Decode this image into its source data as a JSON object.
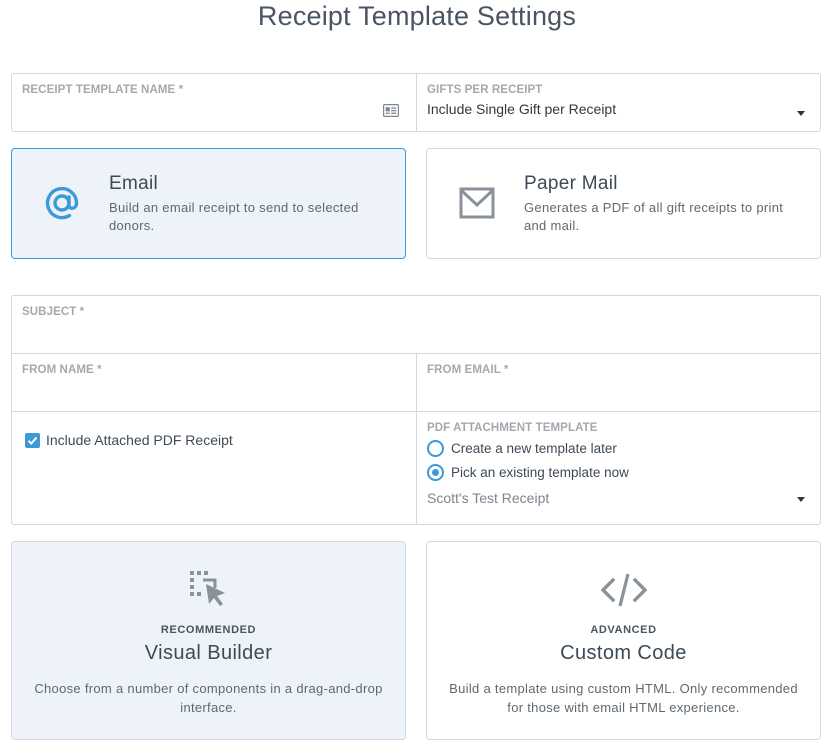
{
  "page": {
    "title": "Receipt Template Settings"
  },
  "top_fields": {
    "template_name": {
      "label": "RECEIPT TEMPLATE NAME *",
      "value": "",
      "icon": "id-card-icon"
    },
    "gifts_per_receipt": {
      "label": "GIFTS PER RECEIPT",
      "value": "Include Single Gift per Receipt",
      "icon": "caret-down-icon"
    }
  },
  "channels": [
    {
      "title": "Email",
      "description": "Build an email receipt to send to selected donors.",
      "icon": "at-sign-icon",
      "selected": true
    },
    {
      "title": "Paper Mail",
      "description": "Generates a PDF of all gift receipts to print and mail.",
      "icon": "envelope-icon",
      "selected": false
    }
  ],
  "email_form": {
    "subject": {
      "label": "SUBJECT *",
      "value": ""
    },
    "from_name": {
      "label": "FROM NAME *",
      "value": ""
    },
    "from_email": {
      "label": "FROM EMAIL *",
      "value": ""
    },
    "include_pdf": {
      "label": "Include Attached PDF Receipt",
      "checked": true
    },
    "pdf_template": {
      "label": "PDF ATTACHMENT TEMPLATE",
      "options": [
        {
          "label": "Create a new template later",
          "checked": false
        },
        {
          "label": "Pick an existing template now",
          "checked": true
        }
      ],
      "selected": "Scott's Test Receipt"
    }
  },
  "builders": [
    {
      "tag": "RECOMMENDED",
      "title": "Visual Builder",
      "description": "Choose from a number of components in a drag-and-drop interface.",
      "icon": "visual-builder-icon",
      "selected": true
    },
    {
      "tag": "ADVANCED",
      "title": "Custom Code",
      "description": "Build a template using custom HTML. Only recommended for those with email HTML experience.",
      "icon": "code-icon",
      "selected": false
    }
  ],
  "colors": {
    "accent": "#3d9ad8",
    "selected_bg": "#edf3f8",
    "border": "#d6d9dc",
    "label": "#a3a9ae"
  }
}
